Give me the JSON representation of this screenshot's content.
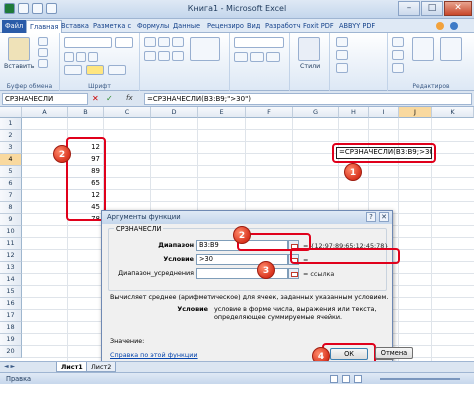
{
  "window": {
    "title": "Книга1 - Microsoft Excel",
    "controls": {
      "minimize": "–",
      "maximize": "□",
      "close": "✕"
    }
  },
  "ribbon": {
    "tabs": [
      "Файл",
      "Главная",
      "Вставка",
      "Разметка с",
      "Формулы",
      "Данные",
      "Рецензиро",
      "Вид",
      "Разработч",
      "Foxit PDF",
      "ABBYY PDF"
    ],
    "active_tab": "Главная",
    "paste_label": "Вставить",
    "styles_label": "Стили",
    "groups": [
      "Буфер обмена",
      "Шрифт",
      "Редактиров"
    ]
  },
  "formula_bar": {
    "name_box": "СРЗНАЧЕСЛИ",
    "fx": "fx",
    "formula": "=СРЗНАЧЕСЛИ(B3:B9;\">30\")"
  },
  "grid": {
    "columns": [
      "A",
      "B",
      "C",
      "D",
      "E",
      "F",
      "G",
      "H",
      "I",
      "J",
      "K"
    ],
    "rows": [
      "1",
      "2",
      "3",
      "4",
      "5",
      "6",
      "7",
      "8",
      "9",
      "10",
      "11",
      "12",
      "13",
      "14",
      "15",
      "16",
      "17",
      "18",
      "19",
      "20"
    ],
    "b_values": [
      "12",
      "97",
      "89",
      "65",
      "12",
      "45",
      "78"
    ],
    "editing_cell_text": "=СРЗНАЧЕСЛИ(B3:B9;>30)"
  },
  "badges": [
    "1",
    "2",
    "3",
    "4"
  ],
  "dialog": {
    "title": "Аргументы функции",
    "help": "?",
    "close": "✕",
    "function_name": "СРЗНАЧЕСЛИ",
    "args": [
      {
        "label": "Диапазон",
        "value": "B3:B9",
        "result": "= {12:97:89:65:12:45:78}"
      },
      {
        "label": "Условие",
        "value": ">30",
        "result": "="
      },
      {
        "label": "Диапазон_усреднения",
        "value": "",
        "result": "= ссылка"
      }
    ],
    "description": "Вычисляет среднее (арифметическое) для ячеек, заданных указанным условием.",
    "arg_help_label": "Условие",
    "arg_help_text": "условие в форме числа, выражения или текста, определяющее суммируемые ячейки.",
    "value_label": "Значение:",
    "help_link": "Справка по этой функции",
    "ok": "ОК",
    "cancel": "Отмена"
  },
  "sheets": [
    "Лист1",
    "Лист2"
  ],
  "status": "Правка"
}
